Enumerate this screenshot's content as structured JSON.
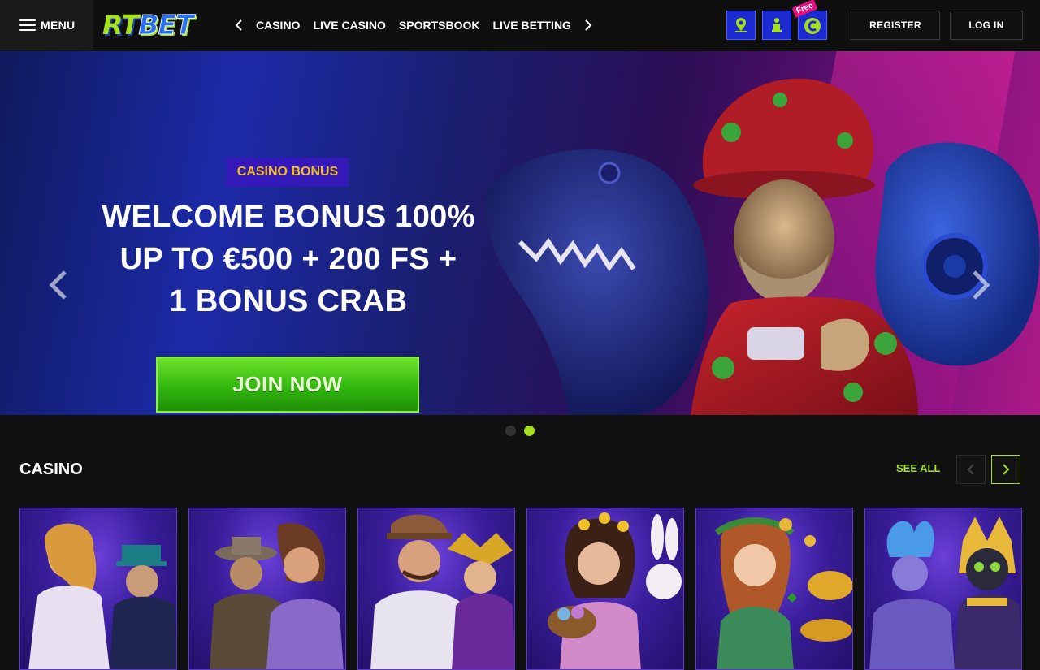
{
  "header": {
    "menu_label": "MENU",
    "logo": {
      "part1": "RT",
      "part2": "BET"
    },
    "nav_items": [
      "CASINO",
      "LIVE CASINO",
      "SPORTSBOOK",
      "LIVE BETTING"
    ],
    "icons": [
      "location-icon",
      "support-agent-icon",
      "coin-icon"
    ],
    "free_tag": "Free",
    "register_label": "REGISTER",
    "login_label": "LOG IN"
  },
  "hero": {
    "badge": "CASINO BONUS",
    "headline_lines": [
      "WELCOME BONUS 100%",
      "UP TO €500 + 200 FS +",
      "1 BONUS CRAB"
    ],
    "cta_label": "JOIN NOW",
    "slides_total": 2,
    "active_slide": 2
  },
  "casino": {
    "title": "CASINO",
    "see_all": "SEE ALL",
    "games": [
      "goddess-magician-game-card",
      "explorers-game-card",
      "detective-jester-game-card",
      "easter-bunny-game-card",
      "irish-fortune-game-card",
      "egyptian-cat-game-card"
    ]
  },
  "colors": {
    "accent_green": "#a7e020",
    "brand_blue": "#2a6df0",
    "badge_bg": "#3418b8",
    "badge_text": "#f3c21a",
    "free_tag": "#e1107d"
  }
}
